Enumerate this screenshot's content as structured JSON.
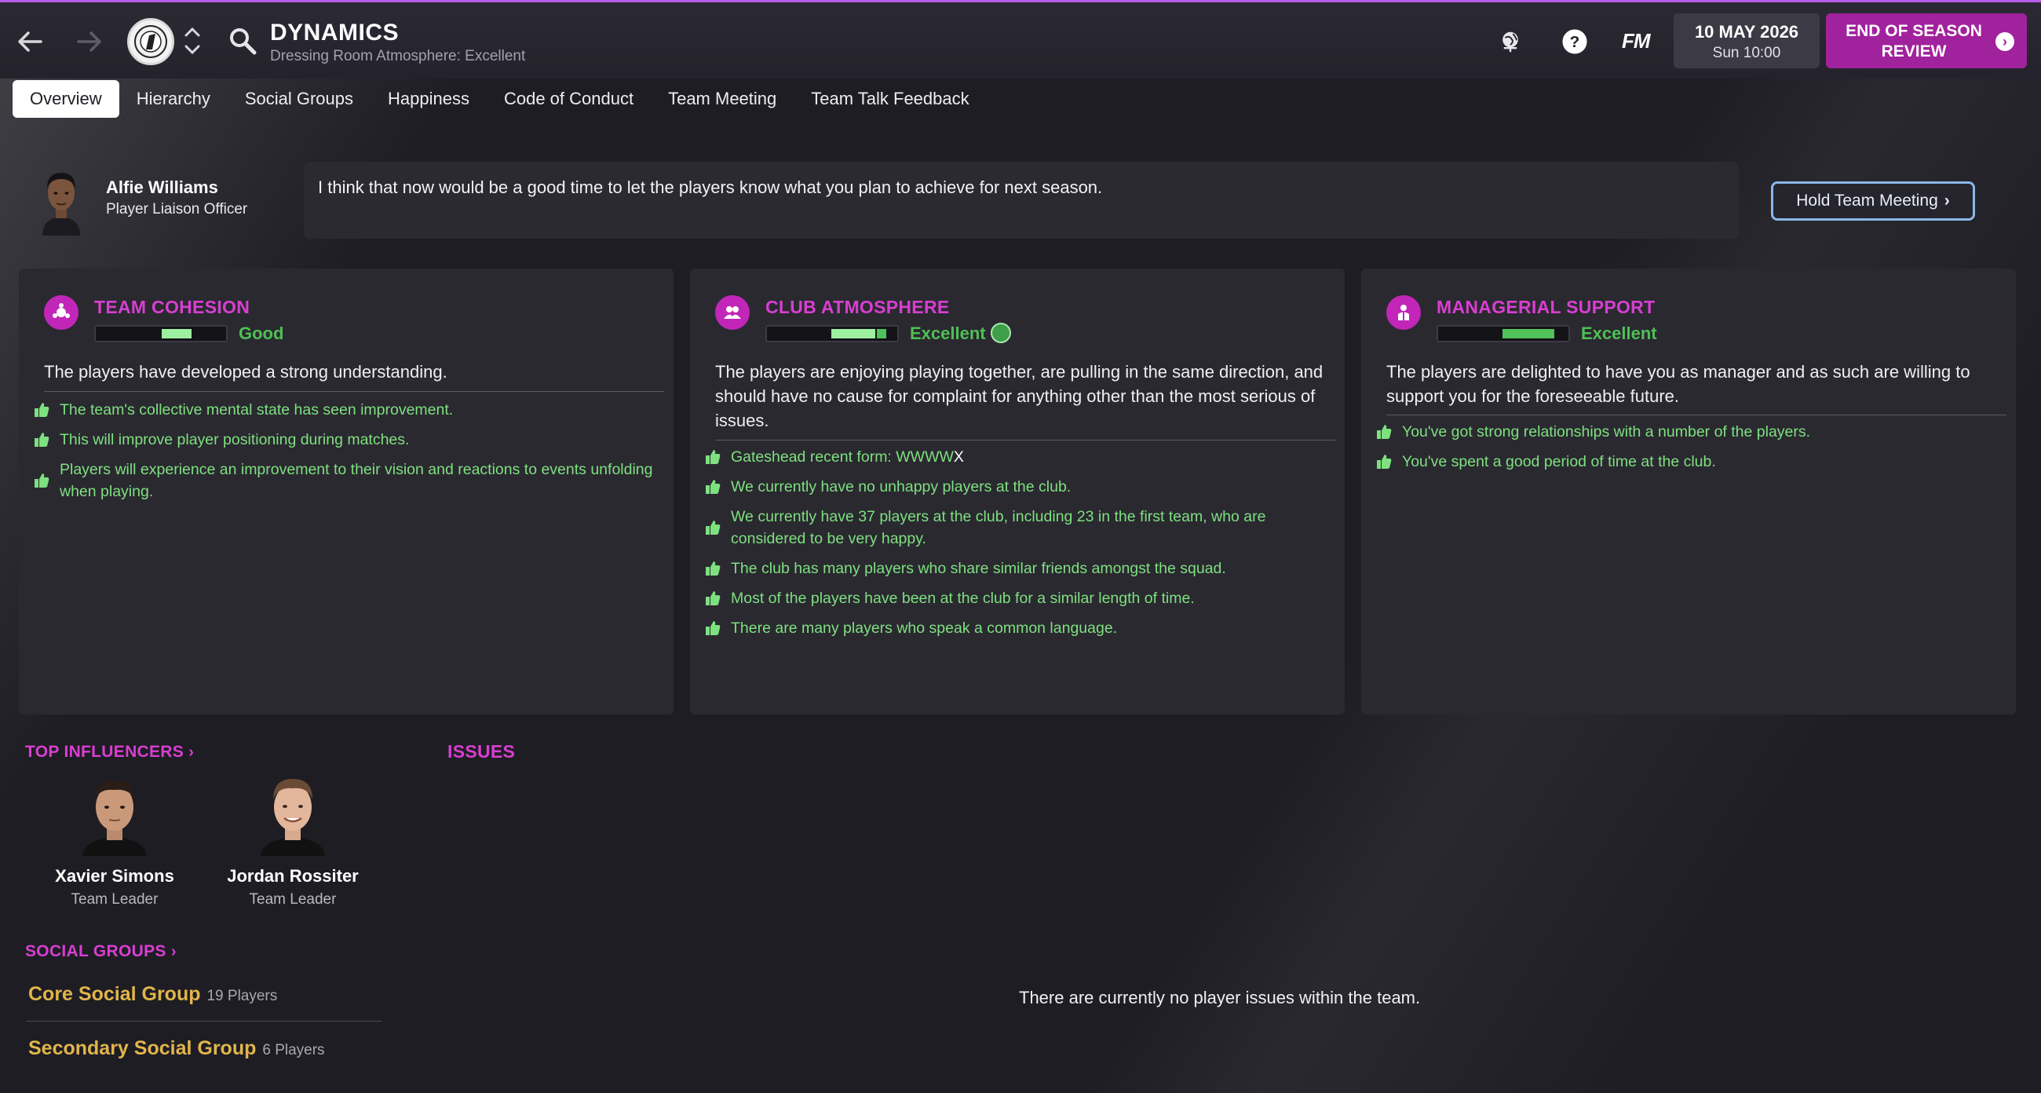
{
  "header": {
    "title": "DYNAMICS",
    "subtitle": "Dressing Room Atmosphere: Excellent",
    "fm_logo": "FM",
    "date": "10 MAY 2026",
    "time": "Sun 10:00",
    "continue_label": "END OF SEASON REVIEW"
  },
  "tabs": [
    {
      "label": "Overview"
    },
    {
      "label": "Hierarchy"
    },
    {
      "label": "Social Groups"
    },
    {
      "label": "Happiness"
    },
    {
      "label": "Code of Conduct"
    },
    {
      "label": "Team Meeting"
    },
    {
      "label": "Team Talk Feedback"
    }
  ],
  "liaison": {
    "name": "Alfie Williams",
    "role": "Player Liaison Officer",
    "message": "I think that now would be a good time to let the players know what you plan to achieve for next season.",
    "button_label": "Hold Team Meeting"
  },
  "panels": {
    "cohesion": {
      "title": "TEAM COHESION",
      "rating": "Good",
      "description": "The players have developed a strong understanding.",
      "bullets": [
        "The team's collective mental state has seen improvement.",
        "This will improve player positioning during matches.",
        "Players will experience an improvement to their vision and reactions to events unfolding when playing."
      ]
    },
    "atmosphere": {
      "title": "CLUB ATMOSPHERE",
      "rating": "Excellent",
      "description": "The players are enjoying playing together, are pulling in the same direction, and should have no cause for complaint for anything other than the most serious of issues.",
      "form_prefix": "Gateshead recent form: WWWW",
      "form_last": "X",
      "bullets": [
        "We currently have no unhappy players at the club.",
        "We currently have 37 players at the club, including 23 in the first team, who are considered to be very happy.",
        "The club has many players who share similar friends amongst the squad.",
        "Most of the players have been at the club for a similar length of time.",
        "There are many players who speak a common language."
      ]
    },
    "support": {
      "title": "MANAGERIAL SUPPORT",
      "rating": "Excellent",
      "description": "The players are delighted to have you as manager and as such are willing to support you for the foreseeable future.",
      "bullets": [
        "You've got strong relationships with a number of the players.",
        "You've spent a good period of time at the club."
      ]
    }
  },
  "influencers": {
    "title": "TOP INFLUENCERS",
    "people": [
      {
        "name": "Xavier Simons",
        "role": "Team Leader"
      },
      {
        "name": "Jordan Rossiter",
        "role": "Team Leader"
      }
    ]
  },
  "social_groups": {
    "title": "SOCIAL GROUPS",
    "groups": [
      {
        "name": "Core Social Group",
        "count": "19 Players"
      },
      {
        "name": "Secondary Social Group",
        "count": "6 Players"
      }
    ]
  },
  "issues": {
    "title": "ISSUES",
    "empty_text": "There are currently no player issues within the team."
  },
  "colors": {
    "accent": "#d83fd1",
    "continue_button": "#a1229d",
    "positive": "#7ee07f",
    "group_name": "#e1b54a"
  }
}
